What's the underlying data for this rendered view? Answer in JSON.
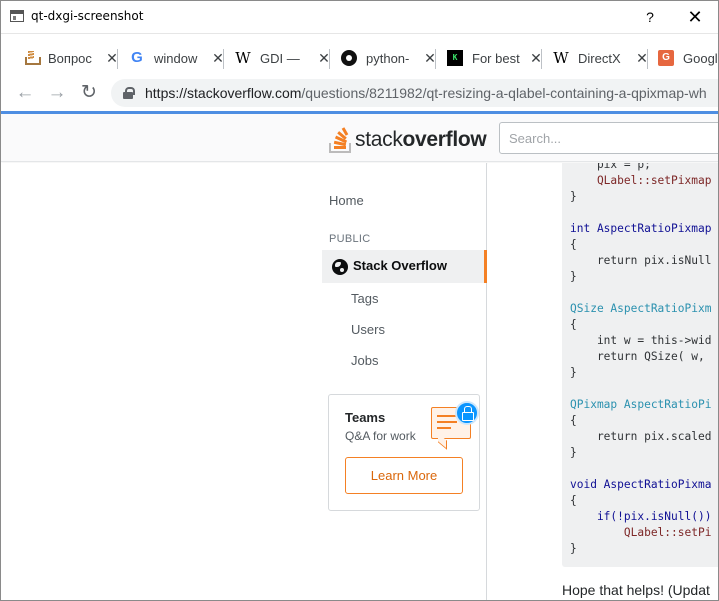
{
  "window": {
    "title": "qt-dxgi-screenshot",
    "help_label": "?",
    "close_label": "✕"
  },
  "tabs": [
    {
      "title": "Вопрос",
      "icon": "stackoverflow-favicon",
      "close": "✕"
    },
    {
      "title": "window",
      "icon": "google-favicon",
      "close": "✕"
    },
    {
      "title": "GDI — ",
      "icon": "wikipedia-favicon",
      "close": "✕"
    },
    {
      "title": "python-",
      "icon": "github-favicon",
      "close": "✕"
    },
    {
      "title": "For best",
      "icon": "khronos-favicon",
      "close": "✕"
    },
    {
      "title": "DirectX",
      "icon": "wikipedia-favicon",
      "close": "✕"
    },
    {
      "title": "Google",
      "icon": "google-translate-favicon",
      "close": ""
    }
  ],
  "favicon_glyphs": {
    "google": "G",
    "wikipedia": "W",
    "khronos": "K",
    "translate": "G"
  },
  "address": {
    "host": "https://stackoverflow.com",
    "path": "/questions/8211982/qt-resizing-a-qlabel-containing-a-qpixmap-wh",
    "back": "←",
    "forward": "→",
    "reload": "↻"
  },
  "header": {
    "logo_plain": "stack",
    "logo_bold": "overflow",
    "search_placeholder": "Search..."
  },
  "sidebar": {
    "home": "Home",
    "section": "PUBLIC",
    "active": "Stack Overflow",
    "items": [
      "Tags",
      "Users",
      "Jobs"
    ]
  },
  "teams": {
    "title": "Teams",
    "subtitle": "Q&A for work",
    "button": "Learn More"
  },
  "code": {
    "lines": [
      "    pix = p;",
      "    QLabel::setPixmap",
      "}",
      "",
      "int AspectRatioPixmap",
      "{",
      "    return pix.isNull",
      "}",
      "",
      "QSize AspectRatioPixm",
      "{",
      "    int w = this->wid",
      "    return QSize( w, ",
      "}",
      "",
      "QPixmap AspectRatioPi",
      "{",
      "    return pix.scaled",
      "}",
      "",
      "void AspectRatioPixma",
      "{",
      "    if(!pix.isNull())",
      "        QLabel::setPi",
      "}"
    ]
  },
  "answer_tail": "Hope that helps! (Updat",
  "colors": {
    "accent": "#f48024",
    "browser_accent": "#4e8ee2",
    "code_bg": "#eff0f1"
  }
}
